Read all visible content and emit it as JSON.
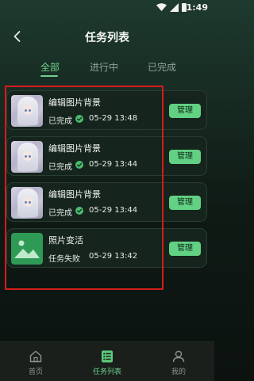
{
  "status_bar": {
    "time": "1:49"
  },
  "header": {
    "title": "任务列表"
  },
  "tabs": [
    {
      "label": "全部",
      "active": true
    },
    {
      "label": "进行中",
      "active": false
    },
    {
      "label": "已完成",
      "active": false
    }
  ],
  "tasks": [
    {
      "title": "编辑图片背景",
      "status": "已完成",
      "time": "05-29 13:48",
      "action": "管理",
      "thumbnail": "anime-girl",
      "success": true
    },
    {
      "title": "编辑图片背景",
      "status": "已完成",
      "time": "05-29 13:44",
      "action": "管理",
      "thumbnail": "anime-girl",
      "success": true
    },
    {
      "title": "编辑图片背景",
      "status": "已完成",
      "time": "05-29 13:44",
      "action": "管理",
      "thumbnail": "anime-girl",
      "success": true
    },
    {
      "title": "照片变活",
      "status": "任务失败",
      "time": "05-29 13:42",
      "action": "管理",
      "thumbnail": "image-placeholder-icon",
      "success": false
    }
  ],
  "bottom_nav": [
    {
      "label": "首页",
      "icon": "home-icon",
      "active": false
    },
    {
      "label": "任务列表",
      "icon": "list-icon",
      "active": true
    },
    {
      "label": "我的",
      "icon": "profile-icon",
      "active": false
    }
  ],
  "colors": {
    "accent": "#62d183",
    "highlight": "#d51c1c",
    "background": "#0f1a15",
    "card": "#15241d"
  }
}
